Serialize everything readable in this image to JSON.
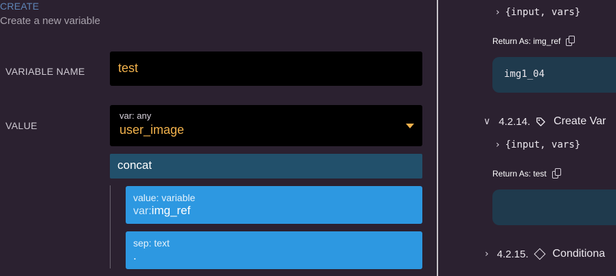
{
  "left": {
    "title": "CREATE",
    "subtitle": "Create a new variable",
    "variable_name_label": "VARIABLE NAME",
    "variable_name_value": "test",
    "value_label": "VALUE",
    "value_select": {
      "hint": "var: any",
      "value": "user_image"
    },
    "concat_label": "concat",
    "cards": [
      {
        "hint": "value: variable",
        "prefix": "var:",
        "value": "img_ref"
      },
      {
        "hint": "sep: text",
        "value": "."
      }
    ]
  },
  "right": {
    "args_top": "{input, vars}",
    "return_as_1": "Return As: img_ref",
    "code_1": "img1_04",
    "section_1": {
      "number": "4.2.14.",
      "title": "Create Var"
    },
    "args_2": "{input, vars}",
    "return_as_2": "Return As: test",
    "code_2": "",
    "section_2": {
      "number": "4.2.15.",
      "title": "Conditiona"
    }
  },
  "icons": {
    "dropdown": "chevron-down-icon",
    "copy": "copy-icon",
    "tag": "tag-icon",
    "diamond": "diamond-icon"
  },
  "colors": {
    "background": "#2b2130",
    "accent_orange": "#f2b24c",
    "card_blue": "#2d98e1",
    "concat_blue": "#22506b",
    "code_box": "#1f3a4d"
  }
}
